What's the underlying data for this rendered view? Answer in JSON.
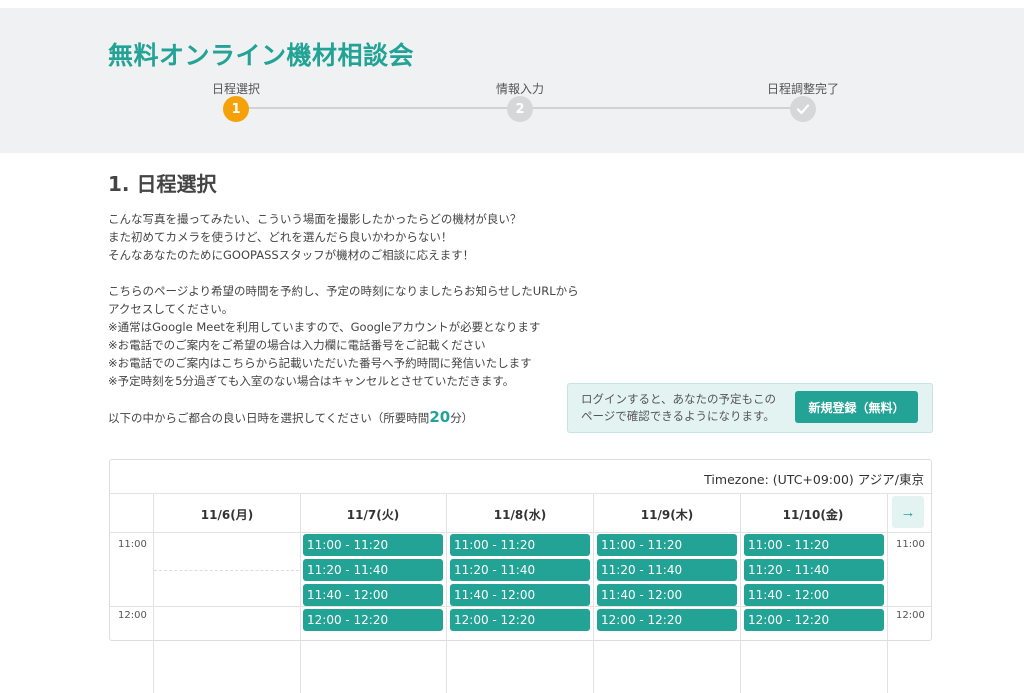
{
  "header": {
    "title": "無料オンライン機材相談会"
  },
  "steps": [
    {
      "label": "日程選択",
      "marker": "1"
    },
    {
      "label": "情報入力",
      "marker": "2"
    },
    {
      "label": "日程調整完了",
      "marker": "✓"
    }
  ],
  "section_title": "1. 日程選択",
  "intro_lines": [
    "こんな写真を撮ってみたい、こういう場面を撮影したかったらどの機材が良い？",
    "また初めてカメラを使うけど、どれを選んだら良いかわからない！",
    "そんなあなたのためにGOOPASSスタッフが機材のご相談に応えます！",
    "",
    "こちらのページより希望の時間を予約し、予定の時刻になりましたらお知らせしたURLから",
    "アクセスしてください。",
    "※通常はGoogle Meetを利用していますので、Googleアカウントが必要となります",
    "※お電話でのご案内をご希望の場合は入力欄に電話番号をご記載ください",
    "※お電話でのご案内はこちらから記載いただいた番号へ予約時間に発信いたします",
    "※予定時刻を5分過ぎても入室のない場合はキャンセルとさせていただきます。"
  ],
  "select_prompt": {
    "before": "以下の中からご都合の良い日時を選択してください（所要時間",
    "minutes": "20",
    "after": "分）"
  },
  "login_box": {
    "text_lines": [
      "ログインすると、あなたの予定もこの",
      "ページで確認できるようになります。"
    ],
    "register_label": "新規登録（無料）"
  },
  "calendar": {
    "timezone": "Timezone: (UTC+09:00) アジア/東京",
    "days": [
      "11/6(月)",
      "11/7(火)",
      "11/8(水)",
      "11/9(木)",
      "11/10(金)"
    ],
    "next_icon": "arrow-right-icon",
    "times": [
      "11:00",
      "12:00"
    ],
    "slots": [
      "11:00 - 11:20",
      "11:20 - 11:40",
      "11:40 - 12:00",
      "12:00 - 12:20"
    ]
  },
  "colors": {
    "accent": "#22a396",
    "step_active": "#f5a20a",
    "step_inactive": "#d5d7d9",
    "header_bg": "#f0f1f2"
  }
}
